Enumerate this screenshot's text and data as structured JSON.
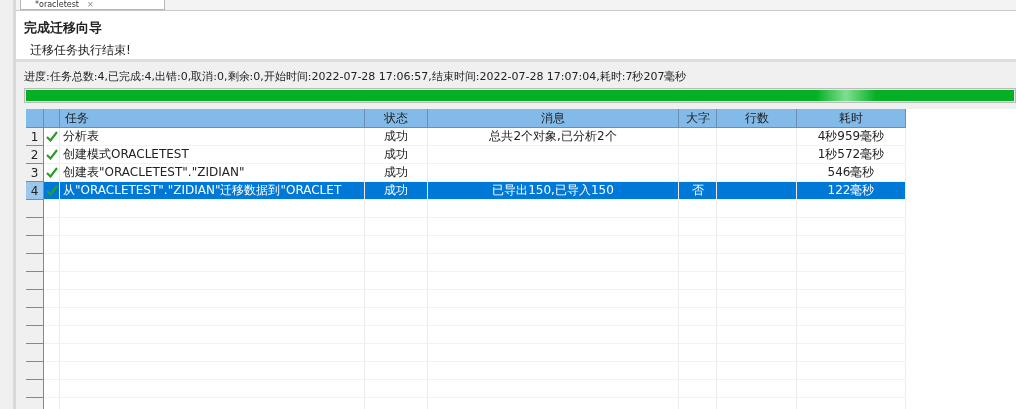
{
  "tab": {
    "title": "*oracletest",
    "close": "×"
  },
  "header": {
    "title": "完成迁移向导",
    "subtitle": "迁移任务执行结束!"
  },
  "progress": {
    "text": "进度:任务总数:4,已完成:4,出错:0,取消:0,剩余:0,开始时间:2022-07-28 17:06:57,结束时间:2022-07-28 17:07:04,耗时:7秒207毫秒",
    "level": 1
  },
  "table": {
    "columns": [
      "任务",
      "状态",
      "消息",
      "大字",
      "行数",
      "耗时"
    ],
    "rows": [
      {
        "num": "1",
        "ok": true,
        "task": "分析表",
        "status": "成功",
        "message": "总共2个对象,已分析2个",
        "big": "",
        "count": "",
        "time": "4秒959毫秒",
        "selected": false
      },
      {
        "num": "2",
        "ok": true,
        "task": "创建模式ORACLETEST",
        "status": "成功",
        "message": "",
        "big": "",
        "count": "",
        "time": "1秒572毫秒",
        "selected": false
      },
      {
        "num": "3",
        "ok": true,
        "task": "创建表\"ORACLETEST\".\"ZIDIAN\"",
        "status": "成功",
        "message": "",
        "big": "",
        "count": "",
        "time": "546毫秒",
        "selected": false
      },
      {
        "num": "4",
        "ok": true,
        "task": "从\"ORACLETEST\".\"ZIDIAN\"迁移数据到\"ORACLET",
        "status": "成功",
        "message": "已导出150,已导入150",
        "big": "否",
        "count": "",
        "time": "122毫秒",
        "selected": true
      }
    ]
  }
}
